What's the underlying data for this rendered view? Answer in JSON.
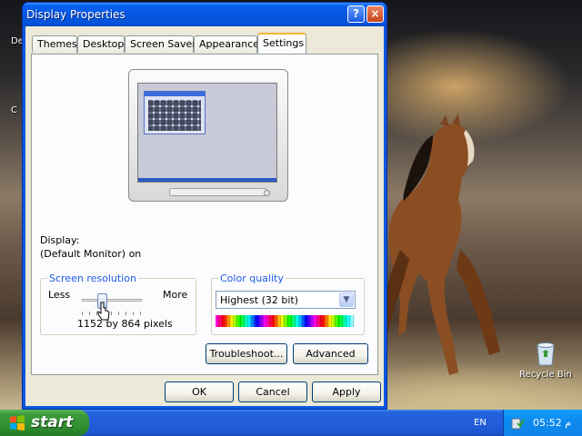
{
  "window": {
    "title": "Display Properties",
    "help_label": "?",
    "close_label": "×"
  },
  "tabs": [
    {
      "label": "Themes"
    },
    {
      "label": "Desktop"
    },
    {
      "label": "Screen Saver"
    },
    {
      "label": "Appearance"
    },
    {
      "label": "Settings"
    }
  ],
  "active_tab": "Settings",
  "settings": {
    "display_label": "Display:",
    "display_value": "(Default Monitor) on",
    "screen_resolution": {
      "title": "Screen resolution",
      "less_label": "Less",
      "more_label": "More",
      "value_text": "1152 by 864 pixels",
      "slider_level": 0.3
    },
    "color_quality": {
      "title": "Color quality",
      "selected": "Highest (32 bit)"
    },
    "troubleshoot_label": "Troubleshoot...",
    "advanced_label": "Advanced"
  },
  "dialog_buttons": {
    "ok": "OK",
    "cancel": "Cancel",
    "apply": "Apply"
  },
  "desktop": {
    "edge_labels": [
      "De",
      "C"
    ],
    "recycle_bin_label": "Recycle Bin"
  },
  "taskbar": {
    "start_label": "start",
    "language": "EN",
    "clock": "05:52 م"
  },
  "colors": {
    "title_blue": "#0a58e0",
    "group_title_blue": "#1d5ae6",
    "start_green": "#319131",
    "taskbar_blue": "#245edb"
  }
}
